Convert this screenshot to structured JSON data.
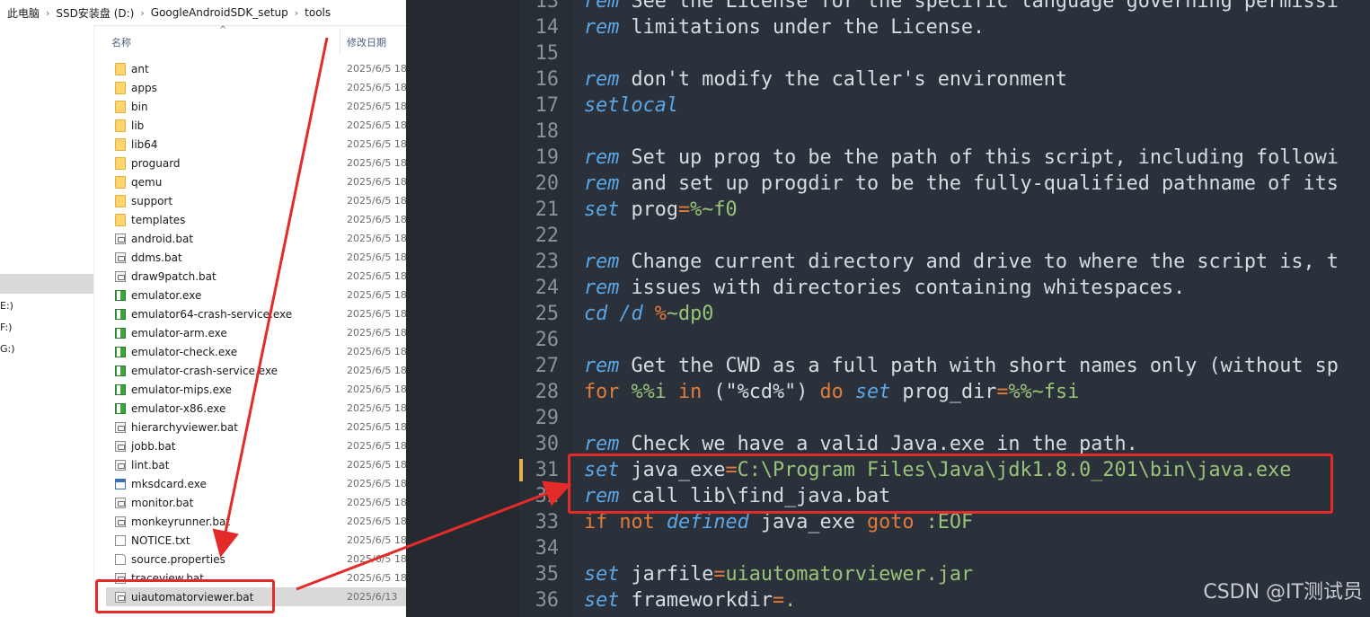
{
  "explorer": {
    "breadcrumb": [
      "此电脑",
      "SSD安装盘 (D:)",
      "GoogleAndroidSDK_setup",
      "tools"
    ],
    "columns": {
      "name": "名称",
      "date": "修改日期"
    },
    "drives": [
      "E:)",
      "F:)",
      "G:)"
    ],
    "files": [
      {
        "name": "ant",
        "type": "folder",
        "date": "2025/6/5 18"
      },
      {
        "name": "apps",
        "type": "folder",
        "date": "2025/6/5 18"
      },
      {
        "name": "bin",
        "type": "folder",
        "date": "2025/6/5 18"
      },
      {
        "name": "lib",
        "type": "folder",
        "date": "2025/6/5 18"
      },
      {
        "name": "lib64",
        "type": "folder",
        "date": "2025/6/5 18"
      },
      {
        "name": "proguard",
        "type": "folder",
        "date": "2025/6/5 18"
      },
      {
        "name": "qemu",
        "type": "folder",
        "date": "2025/6/5 18"
      },
      {
        "name": "support",
        "type": "folder",
        "date": "2025/6/5 18"
      },
      {
        "name": "templates",
        "type": "folder",
        "date": "2025/6/5 18"
      },
      {
        "name": "android.bat",
        "type": "bat",
        "date": "2025/6/5 18"
      },
      {
        "name": "ddms.bat",
        "type": "bat",
        "date": "2025/6/5 18"
      },
      {
        "name": "draw9patch.bat",
        "type": "bat",
        "date": "2025/6/5 18"
      },
      {
        "name": "emulator.exe",
        "type": "exe",
        "date": "2025/6/5 18"
      },
      {
        "name": "emulator64-crash-service.exe",
        "type": "exe",
        "date": "2025/6/5 18"
      },
      {
        "name": "emulator-arm.exe",
        "type": "exe",
        "date": "2025/6/5 18"
      },
      {
        "name": "emulator-check.exe",
        "type": "exe",
        "date": "2025/6/5 18"
      },
      {
        "name": "emulator-crash-service.exe",
        "type": "exe",
        "date": "2025/6/5 18"
      },
      {
        "name": "emulator-mips.exe",
        "type": "exe",
        "date": "2025/6/5 18"
      },
      {
        "name": "emulator-x86.exe",
        "type": "exe",
        "date": "2025/6/5 18"
      },
      {
        "name": "hierarchyviewer.bat",
        "type": "bat",
        "date": "2025/6/5 18"
      },
      {
        "name": "jobb.bat",
        "type": "bat",
        "date": "2025/6/5 18"
      },
      {
        "name": "lint.bat",
        "type": "bat",
        "date": "2025/6/5 18"
      },
      {
        "name": "mksdcard.exe",
        "type": "exeblue",
        "date": "2025/6/5 18"
      },
      {
        "name": "monitor.bat",
        "type": "bat",
        "date": "2025/6/5 18"
      },
      {
        "name": "monkeyrunner.bat",
        "type": "bat",
        "date": "2025/6/5 18"
      },
      {
        "name": "NOTICE.txt",
        "type": "txt",
        "date": "2025/6/5 18"
      },
      {
        "name": "source.properties",
        "type": "file",
        "date": "2025/6/5 18"
      },
      {
        "name": "traceview.bat",
        "type": "bat",
        "date": "2025/6/5 18"
      },
      {
        "name": "uiautomatorviewer.bat",
        "type": "bat",
        "date": "2025/6/13",
        "selected": true
      }
    ]
  },
  "editor": {
    "lines": [
      {
        "n": "13",
        "t": [
          [
            "rem",
            "rm"
          ],
          [
            " See the License for the specific language governing permissi",
            "cmt"
          ]
        ]
      },
      {
        "n": "14",
        "t": [
          [
            "rem",
            "rm"
          ],
          [
            " limitations under the License.",
            "cmt"
          ]
        ]
      },
      {
        "n": "15",
        "t": []
      },
      {
        "n": "16",
        "t": [
          [
            "rem",
            "rm"
          ],
          [
            " don't modify the caller's environment",
            "cmt"
          ]
        ]
      },
      {
        "n": "17",
        "t": [
          [
            "setlocal",
            "kw"
          ]
        ]
      },
      {
        "n": "18",
        "t": []
      },
      {
        "n": "19",
        "t": [
          [
            "rem",
            "rm"
          ],
          [
            " Set up prog to be the path of this script, including followi",
            "cmt"
          ]
        ]
      },
      {
        "n": "20",
        "t": [
          [
            "rem",
            "rm"
          ],
          [
            " and set up progdir to be the fully-qualified pathname of its",
            "cmt"
          ]
        ]
      },
      {
        "n": "21",
        "t": [
          [
            "set",
            "kw"
          ],
          [
            " prog",
            "strv"
          ],
          [
            "=",
            "op"
          ],
          [
            "%~f0",
            "val"
          ]
        ]
      },
      {
        "n": "22",
        "t": []
      },
      {
        "n": "23",
        "t": [
          [
            "rem",
            "rm"
          ],
          [
            " Change current directory and drive to where the script is, t",
            "cmt"
          ]
        ]
      },
      {
        "n": "24",
        "t": [
          [
            "rem",
            "rm"
          ],
          [
            " issues with directories containing whitespaces.",
            "cmt"
          ]
        ]
      },
      {
        "n": "25",
        "t": [
          [
            "cd",
            "kw"
          ],
          [
            " ",
            "strv"
          ],
          [
            "/d",
            "kw"
          ],
          [
            " ",
            "strv"
          ],
          [
            "%",
            "op"
          ],
          [
            "~dp0",
            "val"
          ]
        ]
      },
      {
        "n": "26",
        "t": []
      },
      {
        "n": "27",
        "t": [
          [
            "rem",
            "rm"
          ],
          [
            " Get the CWD as a full path with short names only (without sp",
            "cmt"
          ]
        ]
      },
      {
        "n": "28",
        "t": [
          [
            "for",
            "ctl"
          ],
          [
            " ",
            "strv"
          ],
          [
            "%%i",
            "val"
          ],
          [
            " ",
            "strv"
          ],
          [
            "in",
            "ctl"
          ],
          [
            " (\"%cd%\") ",
            "strv"
          ],
          [
            "do",
            "ctl"
          ],
          [
            " ",
            "strv"
          ],
          [
            "set",
            "kw"
          ],
          [
            " prog_dir",
            "strv"
          ],
          [
            "=",
            "op"
          ],
          [
            "%%~fsi",
            "val"
          ]
        ]
      },
      {
        "n": "29",
        "t": []
      },
      {
        "n": "30",
        "t": [
          [
            "rem",
            "rm"
          ],
          [
            " Check we have a valid Java.exe in the path.",
            "cmt"
          ]
        ]
      },
      {
        "n": "31",
        "mod": true,
        "t": [
          [
            "set",
            "kw"
          ],
          [
            " java_exe",
            "strv"
          ],
          [
            "=",
            "op"
          ],
          [
            "C:\\Program Files\\Java\\jdk1.8.0_201\\bin\\java.exe",
            "val"
          ]
        ]
      },
      {
        "n": "32",
        "t": [
          [
            "rem",
            "rm"
          ],
          [
            " call lib\\find_java.bat",
            "cmt"
          ]
        ]
      },
      {
        "n": "33",
        "t": [
          [
            "if",
            "ctl"
          ],
          [
            " ",
            "strv"
          ],
          [
            "not",
            "ctl"
          ],
          [
            " ",
            "strv"
          ],
          [
            "defined",
            "rm"
          ],
          [
            " java_exe ",
            "strv"
          ],
          [
            "goto",
            "ctl"
          ],
          [
            " ",
            "strv"
          ],
          [
            ":EOF",
            "val"
          ]
        ]
      },
      {
        "n": "34",
        "t": []
      },
      {
        "n": "35",
        "t": [
          [
            "set",
            "kw"
          ],
          [
            " jarfile",
            "strv"
          ],
          [
            "=",
            "op"
          ],
          [
            "uiautomatorviewer.jar",
            "val"
          ]
        ]
      },
      {
        "n": "36",
        "t": [
          [
            "set",
            "kw"
          ],
          [
            " frameworkdir",
            "strv"
          ],
          [
            "=",
            "op"
          ],
          [
            ".",
            "val"
          ]
        ]
      }
    ]
  },
  "watermark": "CSDN @IT测试员",
  "colors": {
    "annotation": "#e52a2a",
    "editor_bg": "#2b313a"
  }
}
